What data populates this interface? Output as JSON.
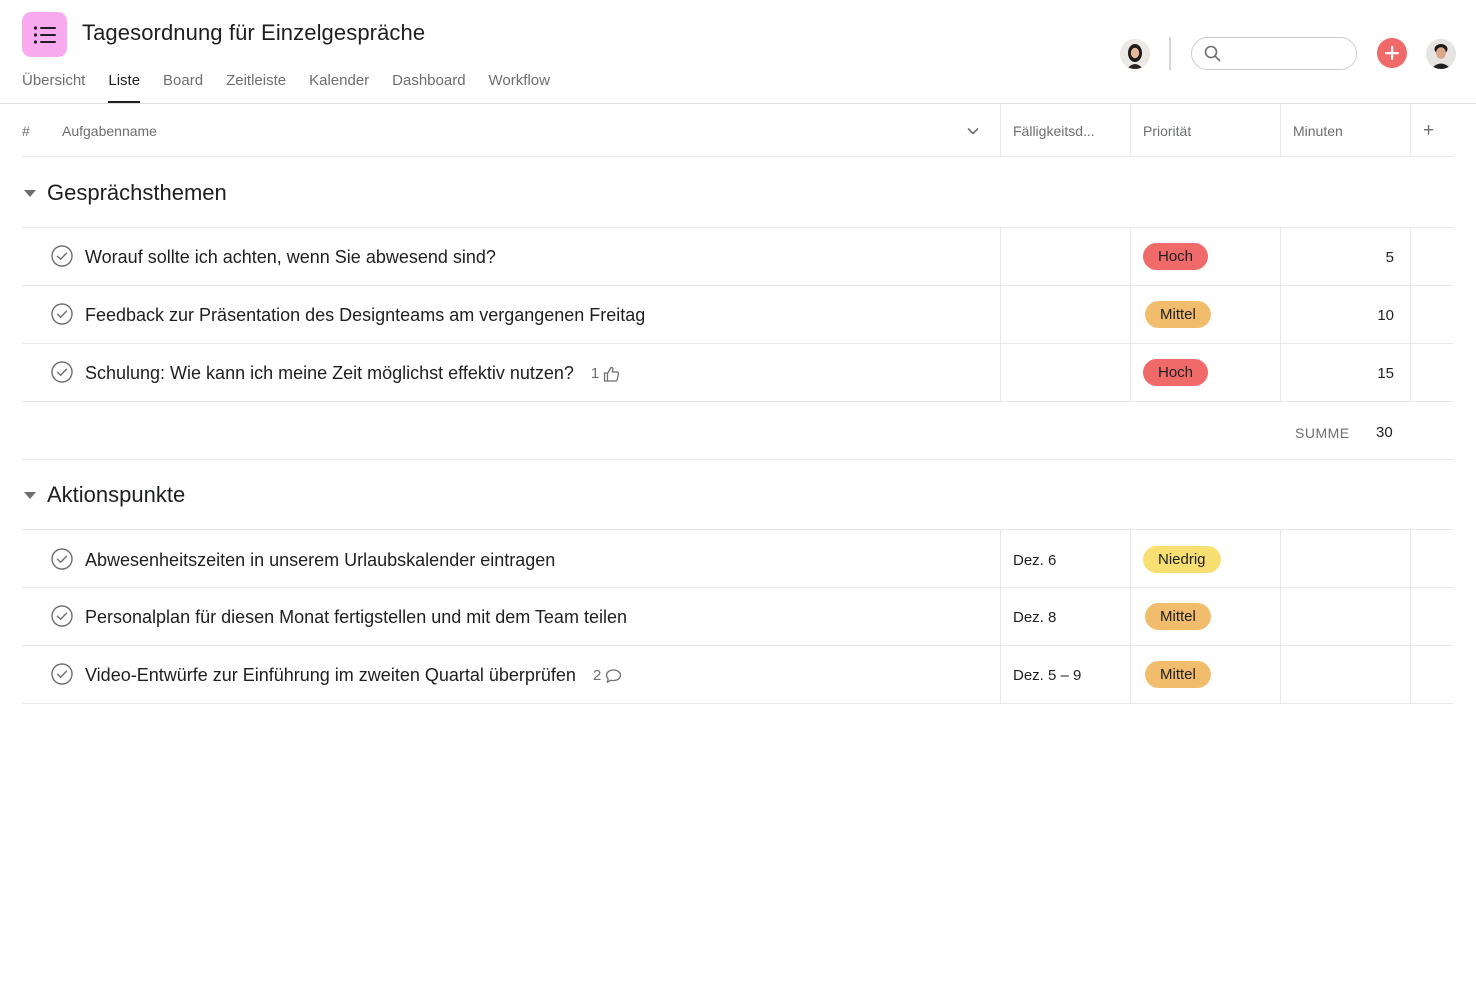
{
  "header": {
    "title": "Tagesordnung für Einzelgespräche",
    "app_icon": "list-icon",
    "brand_color": "#f9aaef"
  },
  "tabs": [
    {
      "label": "Übersicht",
      "active": false
    },
    {
      "label": "Liste",
      "active": true
    },
    {
      "label": "Board",
      "active": false
    },
    {
      "label": "Zeitleiste",
      "active": false
    },
    {
      "label": "Kalender",
      "active": false
    },
    {
      "label": "Dashboard",
      "active": false
    },
    {
      "label": "Workflow",
      "active": false
    }
  ],
  "search": {
    "placeholder": ""
  },
  "columns": {
    "number": "#",
    "task_name": "Aufgabenname",
    "due": "Fälligkeitsd...",
    "priority": "Priorität",
    "minutes": "Minuten",
    "add": "+"
  },
  "priority_colors": {
    "Hoch": "#f06a6a",
    "Mittel": "#f1bd6c",
    "Niedrig": "#f8df72"
  },
  "sections": [
    {
      "title": "Gesprächsthemen",
      "tasks": [
        {
          "name": "Worauf sollte ich achten, wenn Sie abwesend sind?",
          "due": "",
          "priority": "Hoch",
          "minutes": "5",
          "meta": ""
        },
        {
          "name": "Feedback zur Präsentation des Designteams am vergangenen Freitag",
          "due": "",
          "priority": "Mittel",
          "minutes": "10",
          "meta": ""
        },
        {
          "name": "Schulung: Wie kann ich meine Zeit möglichst effektiv nutzen?",
          "due": "",
          "priority": "Hoch",
          "minutes": "15",
          "meta": "1",
          "meta_icon": "thumbs-up-icon"
        }
      ],
      "sum_label": "SUMME",
      "sum_value": "30"
    },
    {
      "title": "Aktionspunkte",
      "tasks": [
        {
          "name": "Abwesenheitszeiten in unserem Urlaubskalender eintragen",
          "due": "Dez. 6",
          "priority": "Niedrig",
          "minutes": "",
          "meta": ""
        },
        {
          "name": "Personalplan für diesen Monat fertigstellen und mit dem Team teilen",
          "due": "Dez. 8",
          "priority": "Mittel",
          "minutes": "",
          "meta": ""
        },
        {
          "name": "Video-Entwürfe zur Einführung im zweiten Quartal überprüfen",
          "due": "Dez. 5 – 9",
          "priority": "Mittel",
          "minutes": "",
          "meta": "2",
          "meta_icon": "comment-icon"
        }
      ]
    }
  ]
}
